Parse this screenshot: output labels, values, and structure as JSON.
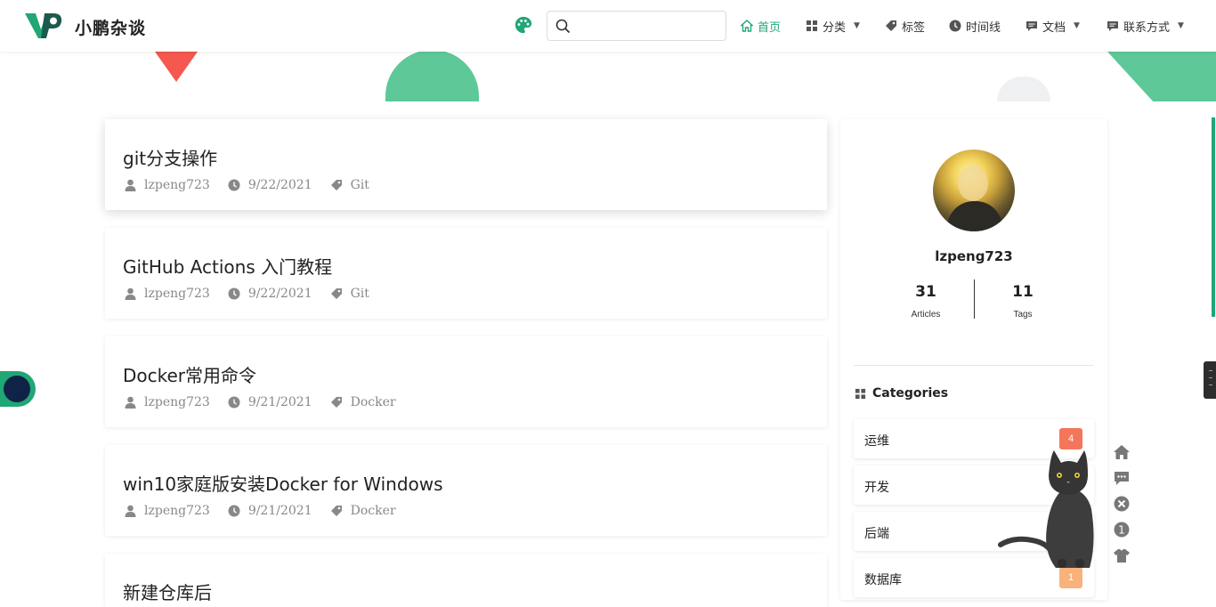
{
  "site": {
    "title": "小鹏杂谈"
  },
  "search": {
    "placeholder": ""
  },
  "nav": [
    {
      "label": "首页",
      "icon": "home-icon",
      "active": true
    },
    {
      "label": "分类",
      "icon": "grid-icon",
      "dropdown": true
    },
    {
      "label": "标签",
      "icon": "tag-icon"
    },
    {
      "label": "时间线",
      "icon": "clock-icon"
    },
    {
      "label": "文档",
      "icon": "comment-icon",
      "dropdown": true
    },
    {
      "label": "联系方式",
      "icon": "comment-icon",
      "dropdown": true
    }
  ],
  "articles": [
    {
      "title": "git分支操作",
      "author": "lzpeng723",
      "date": "9/22/2021",
      "tag": "Git"
    },
    {
      "title": "GitHub Actions 入门教程",
      "author": "lzpeng723",
      "date": "9/22/2021",
      "tag": "Git"
    },
    {
      "title": "Docker常用命令",
      "author": "lzpeng723",
      "date": "9/21/2021",
      "tag": "Docker"
    },
    {
      "title": "win10家庭版安装Docker for Windows",
      "author": "lzpeng723",
      "date": "9/21/2021",
      "tag": "Docker"
    },
    {
      "title": "新建仓库后",
      "author": "",
      "date": "",
      "tag": ""
    }
  ],
  "profile": {
    "name": "lzpeng723",
    "articles_count": "31",
    "articles_label": "Articles",
    "tags_count": "11",
    "tags_label": "Tags"
  },
  "categories": {
    "heading": "Categories",
    "items": [
      {
        "name": "运维",
        "count": "4",
        "color": "#f4765a"
      },
      {
        "name": "开发",
        "count": "",
        "color": "#f4765a"
      },
      {
        "name": "后端",
        "count": "",
        "color": "#e95a4a"
      },
      {
        "name": "数据库",
        "count": "1",
        "color": "#f9b27c"
      }
    ]
  },
  "colors": {
    "accent": "#21a675",
    "triangle": "#f4584e",
    "shape_green": "#5ec898"
  }
}
